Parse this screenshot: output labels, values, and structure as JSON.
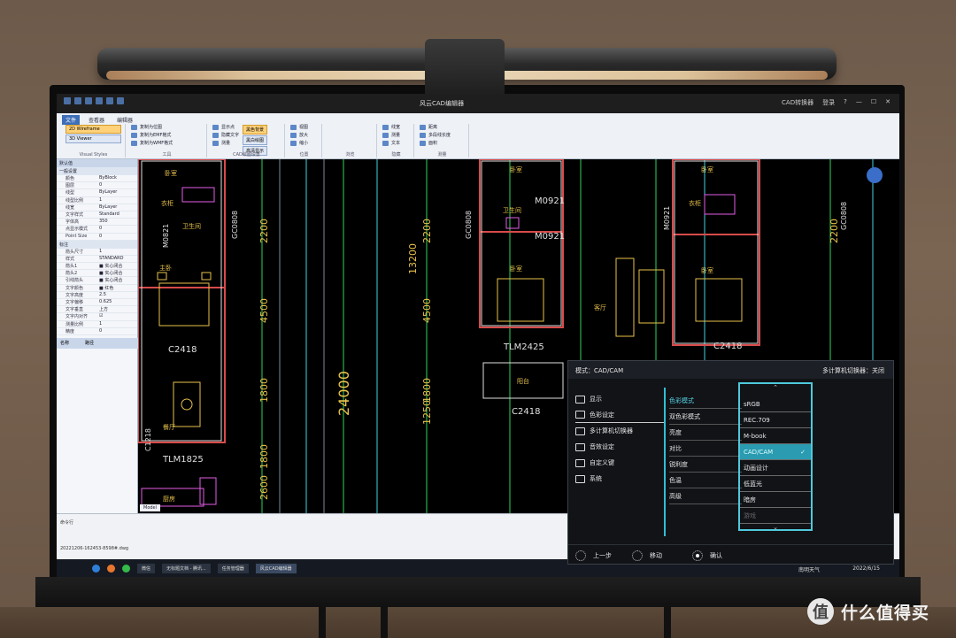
{
  "cad_app": {
    "window_title": "风云CAD编辑器",
    "ribbon_tabs": [
      "文件",
      "查看器",
      "编辑器"
    ],
    "active_tab": "查看器",
    "titlebar_right": [
      "CAD转换器",
      "登录",
      "?"
    ],
    "groups": [
      {
        "label": "Visual Styles",
        "items": [
          "2D Wireframe",
          "3D Viewer"
        ]
      },
      {
        "label": "工具",
        "items": [
          "复制为位图",
          "复制为EMF格式",
          "复制为WMF格式"
        ]
      },
      {
        "label": "CAD绘图设置",
        "items": [
          "显示点",
          "隐藏文字",
          "测量",
          "黑色背景",
          "黑白绘图",
          "高清显示"
        ]
      },
      {
        "label": "位置",
        "items": [
          "视图",
          "放大",
          "缩小"
        ]
      },
      {
        "label": "浏览",
        "items": []
      },
      {
        "label": "隐藏",
        "items": [
          "线宽",
          "测量",
          "文本"
        ]
      },
      {
        "label": "测量",
        "items": [
          "距离",
          "多段线长度",
          "面积"
        ]
      }
    ]
  },
  "properties": {
    "header": "默认值",
    "section1": "一般设置",
    "rows": [
      {
        "k": "颜色",
        "v": "ByBlock"
      },
      {
        "k": "图层",
        "v": "0"
      },
      {
        "k": "线型",
        "v": "ByLayer"
      },
      {
        "k": "线型比例",
        "v": "1"
      },
      {
        "k": "线宽",
        "v": "ByLayer"
      },
      {
        "k": "文字样式",
        "v": "Standard"
      },
      {
        "k": "字体高",
        "v": "350"
      },
      {
        "k": "点显示模式",
        "v": "0"
      },
      {
        "k": "Point Size",
        "v": "0"
      }
    ],
    "section2": "标注",
    "rows2": [
      {
        "k": "箭头尺寸",
        "v": "1"
      },
      {
        "k": "样式",
        "v": "STANDARD"
      },
      {
        "k": "箭头1",
        "v": "■ 实心闭合"
      },
      {
        "k": "箭头2",
        "v": "■ 实心闭合"
      },
      {
        "k": "引线箭头",
        "v": "■ 实心闭合"
      },
      {
        "k": "文字颜色",
        "v": "■ 红色"
      },
      {
        "k": "文字高度",
        "v": "2.5"
      },
      {
        "k": "文字偏移",
        "v": "0.625"
      },
      {
        "k": "文字垂直",
        "v": "上方"
      },
      {
        "k": "文字内对齐",
        "v": "☑"
      },
      {
        "k": "测量比例",
        "v": "1"
      },
      {
        "k": "精度",
        "v": "0"
      }
    ],
    "bottom_headers": [
      "名称",
      "路径"
    ]
  },
  "drawing": {
    "labels": {
      "bedroom": "卧室",
      "bathroom": "卫生间",
      "master_bedroom": "主卧",
      "living": "客厅",
      "dining": "餐厅",
      "kitchen": "厨房",
      "balcony": "阳台",
      "cloak": "衣柜",
      "door1": "M0921",
      "door2": "M0821",
      "win1": "GC0808",
      "win2": "C2418",
      "win3": "TLM2425",
      "win4": "TLM1825",
      "win5": "C1218",
      "dim1": "2200",
      "dim2": "4500",
      "dim3": "1800",
      "dim4": "2600",
      "dim5": "13200",
      "dim6": "24000",
      "dim7": "1250"
    },
    "model_tab": "Model"
  },
  "cmdline": {
    "label": "命令行",
    "file": "20221206-162453-8598#.dwg"
  },
  "taskbar": {
    "tasks": [
      "微信",
      "无标题文档 - 腾讯...",
      "任务管理器",
      "风云CAD编辑器"
    ],
    "active_task": "风云CAD编辑器",
    "tray_text": "南明天气",
    "date": "2022/6/15"
  },
  "osd": {
    "mode_label": "模式：CAD/CAM",
    "kvm_label": "多计算机切换器：关闭",
    "main_menu": [
      "显示",
      "色彩设定",
      "多计算机切换器",
      "音效设定",
      "自定义键",
      "系统"
    ],
    "main_selected": "色彩设定",
    "sub_menu": [
      "色彩模式",
      "双色彩模式",
      "亮度",
      "对比",
      "锐利度",
      "色温",
      "高级"
    ],
    "sub_selected": "色彩模式",
    "options": [
      "sRGB",
      "REC.709",
      "M-book",
      "CAD/CAM",
      "动画设计",
      "低蓝光",
      "暗房",
      "游戏"
    ],
    "option_selected": "CAD/CAM",
    "footer": [
      "上一步",
      "移动",
      "确认"
    ]
  },
  "watermark": {
    "badge": "值",
    "text": "什么值得买"
  },
  "colors": {
    "osd_accent": "#4fc9dc",
    "lamp_glow": "#ffe9c6",
    "cad_yellow": "#e8c24a",
    "cad_green": "#2fd35c",
    "cad_magenta": "#e35ce8",
    "cad_cyan": "#40d4e0"
  }
}
